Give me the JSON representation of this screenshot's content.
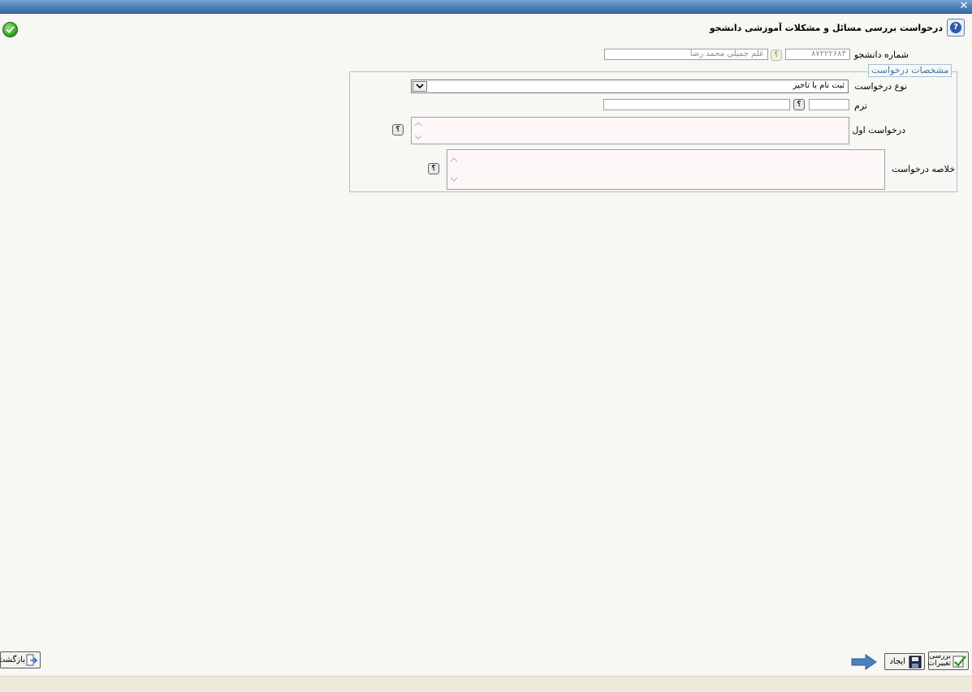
{
  "window": {
    "close_label": "✕"
  },
  "header": {
    "title": "درخواست بررسی مسائل و مشکلات آموزشی دانشجو"
  },
  "student": {
    "label": "شماره دانشجو",
    "number": "۸۷۲۲۲۶۸۳",
    "name": "علم جمیلی محمد رضا",
    "lookup_label": "؟"
  },
  "request": {
    "legend": "مشخصات درخواست",
    "type_label": "نوع درخواست",
    "type_value": "ثبت نام با تاخیر",
    "term_label": "ترم",
    "term_value": "",
    "term_desc": "",
    "first_request_label": "درخواست اول",
    "summary_label": "خلاصه درخواست",
    "help_label": "؟"
  },
  "footer": {
    "back_label": "بازگشت",
    "create_label": "ایجاد",
    "review_label": "بررسی تغییرات"
  },
  "colors": {
    "accent": "#4f7fb8",
    "legend": "#4674a8",
    "arrow": "#4a7fc0"
  }
}
